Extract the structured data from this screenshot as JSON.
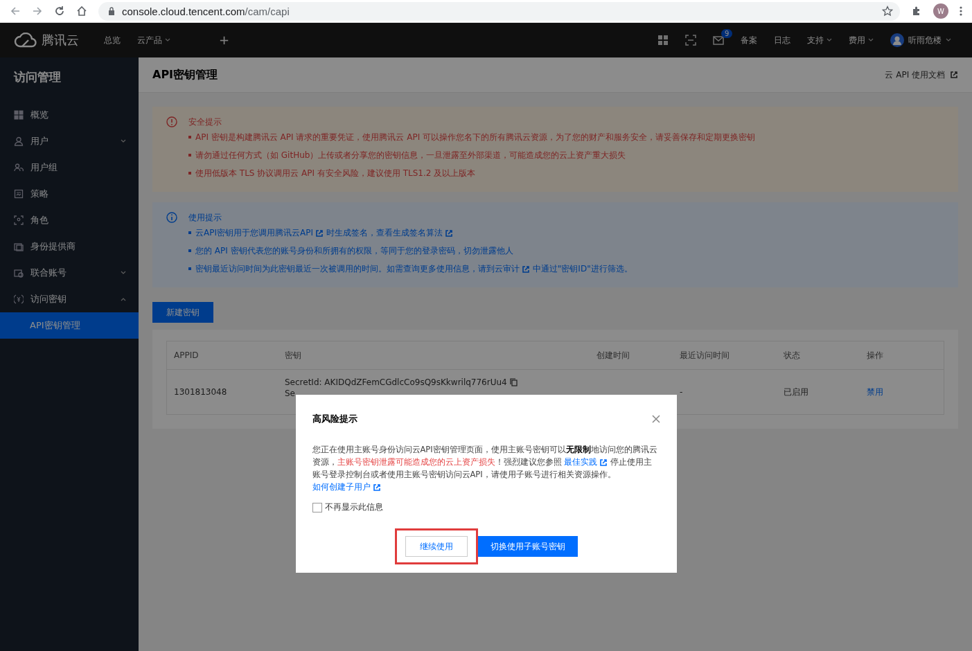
{
  "browser": {
    "url_host": "console.cloud.tencent.com",
    "url_path": "/cam/capi",
    "profile": "W"
  },
  "header": {
    "logo": "腾讯云",
    "nav": [
      {
        "label": "总览",
        "dropdown": false
      },
      {
        "label": "云产品",
        "dropdown": true
      }
    ],
    "plus": "+",
    "mail_badge": "9",
    "links": [
      {
        "label": "备案",
        "dropdown": false
      },
      {
        "label": "日志",
        "dropdown": false
      },
      {
        "label": "支持",
        "dropdown": true
      },
      {
        "label": "费用",
        "dropdown": true
      }
    ],
    "user": "听雨危楼"
  },
  "sidebar": {
    "title": "访问管理",
    "items": [
      {
        "label": "概览",
        "kind": "plain",
        "selected": false
      },
      {
        "label": "用户",
        "kind": "group",
        "expanded": false,
        "selected": false
      },
      {
        "label": "用户组",
        "kind": "plain",
        "selected": false
      },
      {
        "label": "策略",
        "kind": "plain",
        "selected": false
      },
      {
        "label": "角色",
        "kind": "plain",
        "selected": false
      },
      {
        "label": "身份提供商",
        "kind": "plain",
        "selected": false
      },
      {
        "label": "联合账号",
        "kind": "group",
        "expanded": false,
        "selected": false
      },
      {
        "label": "访问密钥",
        "kind": "group",
        "expanded": true,
        "selected": false,
        "children": [
          {
            "label": "API密钥管理",
            "selected": true
          }
        ]
      }
    ]
  },
  "page": {
    "title": "API密钥管理",
    "doc_link": "云 API 使用文档"
  },
  "notices": [
    {
      "kind": "warning",
      "title": "安全提示",
      "bullets": [
        [
          {
            "kind": "text",
            "text": "API 密钥是构建腾讯云 API 请求的重要凭证，使用腾讯云 API 可以操作您名下的所有腾讯云资源，为了您的财产和服务安全，请妥善保存和定期更换密钥"
          }
        ],
        [
          {
            "kind": "text",
            "text": "请勿通过任何方式（如 GitHub）上传或者分享您的密钥信息，一旦泄露至外部渠道，可能造成您的云上资产重大损失"
          }
        ],
        [
          {
            "kind": "text",
            "text": "使用低版本 TLS 协议调用云 API 有安全风险，建议使用 TLS1.2 及以上版本"
          }
        ]
      ]
    },
    {
      "kind": "info",
      "title": "使用提示",
      "bullets": [
        [
          {
            "kind": "link",
            "text": "云API密钥用于您调用腾讯云API"
          },
          {
            "kind": "text",
            "text": "时生成签名，"
          },
          {
            "kind": "link",
            "text": "查看生成签名算法"
          }
        ],
        [
          {
            "kind": "text",
            "text": "您的 API 密钥代表您的账号身份和所拥有的权限，等同于您的登录密码，切勿泄露他人"
          }
        ],
        [
          {
            "kind": "text",
            "text": "密钥最近访问时间为此密钥最近一次被调用的时间。如需查询更多使用信息，请到"
          },
          {
            "kind": "link",
            "text": "云审计"
          },
          {
            "kind": "text",
            "text": "中通过\"密钥ID\"进行筛选。"
          }
        ]
      ]
    }
  ],
  "create_button": "新建密钥",
  "table": {
    "columns": [
      "APPID",
      "密钥",
      "创建时间",
      "最近访问时间",
      "状态",
      "操作"
    ],
    "rows": [
      {
        "appid": "1301813048",
        "secret_id": "SecretId: AKIDQdZFemCGdlcCo9sQ9sKkwrilq776rUu4",
        "secret_key": "Se",
        "last_access": "-",
        "status": "已启用",
        "action": "禁用"
      }
    ]
  },
  "modal": {
    "title": "高风险提示",
    "message": [
      {
        "kind": "text",
        "text": "您正在使用主账号身份访问云API密钥管理页面，使用主账号密钥可以"
      },
      {
        "kind": "bold",
        "text": "无限制"
      },
      {
        "kind": "text",
        "text": "地访问您的腾讯云资源，"
      },
      {
        "kind": "danger",
        "text": "主账号密钥泄露可能造成您的云上资产损失"
      },
      {
        "kind": "text",
        "text": "！强烈建议您参照 "
      },
      {
        "kind": "link",
        "text": "最佳实践"
      },
      {
        "kind": "text",
        "text": " 停止使用主账号登录控制台或者使用主账号密钥访问云API，请使用子账号进行相关资源操作。"
      },
      {
        "kind": "link",
        "text": "如何创建子用户"
      }
    ],
    "checkbox": {
      "label": "不再显示此信息",
      "checked": false
    },
    "buttons": [
      {
        "label": "继续使用",
        "kind": "secondary",
        "highlighted": true
      },
      {
        "label": "切换使用子账号密钥",
        "kind": "primary",
        "highlighted": false
      }
    ]
  }
}
